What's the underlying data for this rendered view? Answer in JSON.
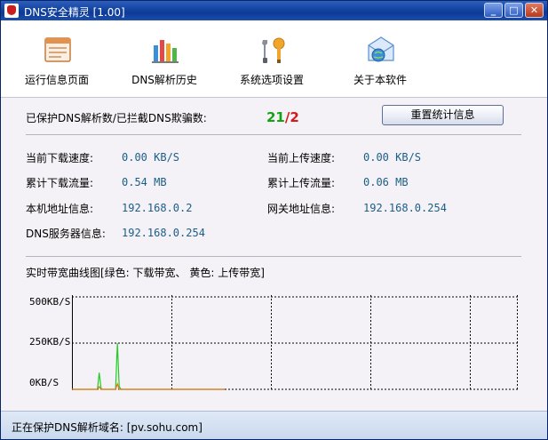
{
  "window": {
    "title": "DNS安全精灵 [1.00]",
    "controls": [
      "minimize",
      "maximize",
      "close"
    ]
  },
  "toolbar": {
    "items": [
      {
        "label": "运行信息页面",
        "icon": "window-page-icon"
      },
      {
        "label": "DNS解析历史",
        "icon": "bar-chart-icon"
      },
      {
        "label": "系统选项设置",
        "icon": "wrench-screwdriver-icon"
      },
      {
        "label": "关于本软件",
        "icon": "mail-globe-icon"
      }
    ]
  },
  "stats": {
    "protected_label": "已保护DNS解析数/已拦截DNS欺骗数:",
    "protected_count": "21",
    "slash": "/",
    "blocked_count": "2",
    "reset_button": "重置统计信息"
  },
  "info": {
    "download_speed_label": "当前下载速度:",
    "download_speed": "0.00 KB/S",
    "upload_speed_label": "当前上传速度:",
    "upload_speed": "0.00 KB/S",
    "download_total_label": "累计下载流量:",
    "download_total": "0.54 MB",
    "upload_total_label": "累计上传流量:",
    "upload_total": "0.06 MB",
    "local_addr_label": "本机地址信息:",
    "local_addr": "192.168.0.2",
    "gateway_label": "网关地址信息:",
    "gateway": "192.168.0.254",
    "dns_server_label": "DNS服务器信息:",
    "dns_server": "192.168.0.254"
  },
  "chart_section": {
    "title": "实时带宽曲线图[绿色: 下载带宽、 黄色: 上传带宽]"
  },
  "chart_data": {
    "type": "line",
    "ylabel_ticks": [
      "500KB/S",
      "250KB/S",
      "0KB/S"
    ],
    "ylim": [
      0,
      500
    ],
    "grid": true,
    "colors": {
      "download": "#22cc22",
      "upload": "#e8741a"
    },
    "series": [
      {
        "name": "下载带宽",
        "values": [
          0,
          0,
          0,
          0,
          0,
          0,
          0,
          0,
          0,
          0,
          0,
          0,
          0,
          0,
          0,
          90,
          5,
          0,
          0,
          0,
          0,
          0,
          0,
          0,
          0,
          250,
          15,
          0,
          0,
          0,
          0,
          0,
          0,
          0,
          0,
          0,
          0,
          0,
          0,
          0,
          0,
          0,
          0,
          0,
          0,
          0,
          0,
          0,
          0,
          0,
          0,
          0,
          0,
          0,
          0,
          0,
          0,
          0,
          0,
          0,
          0,
          0,
          0,
          0,
          0,
          0,
          0,
          0,
          0,
          0,
          0,
          0,
          0,
          0,
          0,
          0,
          0,
          0,
          0,
          0,
          0,
          0,
          0,
          0,
          0
        ]
      },
      {
        "name": "上传带宽",
        "values": [
          0,
          0,
          0,
          0,
          0,
          0,
          0,
          0,
          0,
          0,
          0,
          0,
          0,
          0,
          0,
          15,
          0,
          0,
          0,
          0,
          0,
          0,
          0,
          0,
          0,
          30,
          0,
          0,
          0,
          0,
          0,
          0,
          0,
          0,
          0,
          0,
          0,
          0,
          0,
          0,
          0,
          0,
          0,
          0,
          0,
          0,
          0,
          0,
          0,
          0,
          0,
          0,
          0,
          0,
          0,
          0,
          0,
          0,
          0,
          0,
          0,
          0,
          0,
          0,
          0,
          0,
          0,
          0,
          0,
          0,
          0,
          0,
          0,
          0,
          0,
          0,
          0,
          0,
          0,
          0,
          0,
          0,
          0,
          0,
          0
        ]
      }
    ]
  },
  "status": {
    "text": "正在保护DNS解析域名: [pv.sohu.com]"
  }
}
